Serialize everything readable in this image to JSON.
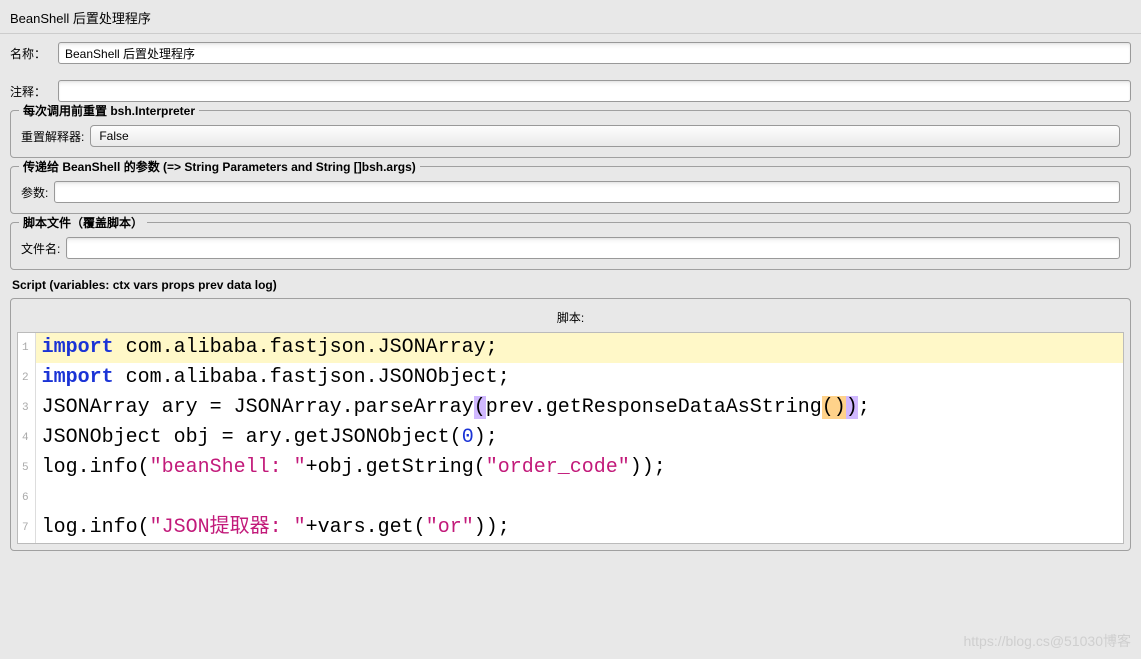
{
  "header": {
    "title": "BeanShell 后置处理程序"
  },
  "fields": {
    "name_label": "名称：",
    "name_value": "BeanShell 后置处理程序",
    "comment_label": "注释：",
    "comment_value": ""
  },
  "interpreter": {
    "section_title": "每次调用前重置 bsh.Interpreter",
    "label": "重置解释器:",
    "value": "False"
  },
  "parameters": {
    "section_title": "传递给 BeanShell 的参数 (=> String Parameters and String []bsh.args)",
    "label": "参数:",
    "value": ""
  },
  "script_file": {
    "section_title": "脚本文件（覆盖脚本）",
    "label": "文件名:",
    "value": ""
  },
  "script": {
    "header": "Script (variables: ctx vars props prev data log)",
    "subtitle": "脚本:",
    "lines": [
      {
        "num": "1",
        "hl": true,
        "tokens": [
          [
            "kw",
            "import"
          ],
          [
            "",
            ", "
          ],
          [
            "",
            "com.alibaba.fastjson.JSONArray;"
          ]
        ],
        "raw": "import com.alibaba.fastjson.JSONArray;"
      },
      {
        "num": "2",
        "hl": false,
        "raw": "import com.alibaba.fastjson.JSONObject;"
      },
      {
        "num": "3",
        "hl": false,
        "raw": "JSONArray ary = JSONArray.parseArray(prev.getResponseDataAsString());"
      },
      {
        "num": "4",
        "hl": false,
        "raw": "JSONObject obj = ary.getJSONObject(0);"
      },
      {
        "num": "5",
        "hl": false,
        "raw": "log.info(\"beanShell: \"+obj.getString(\"order_code\"));"
      },
      {
        "num": "6",
        "hl": false,
        "raw": ""
      },
      {
        "num": "7",
        "hl": false,
        "raw": "log.info(\"JSON提取器: \"+vars.get(\"or\"));"
      }
    ]
  },
  "watermark": "https://blog.cs@51030博客"
}
